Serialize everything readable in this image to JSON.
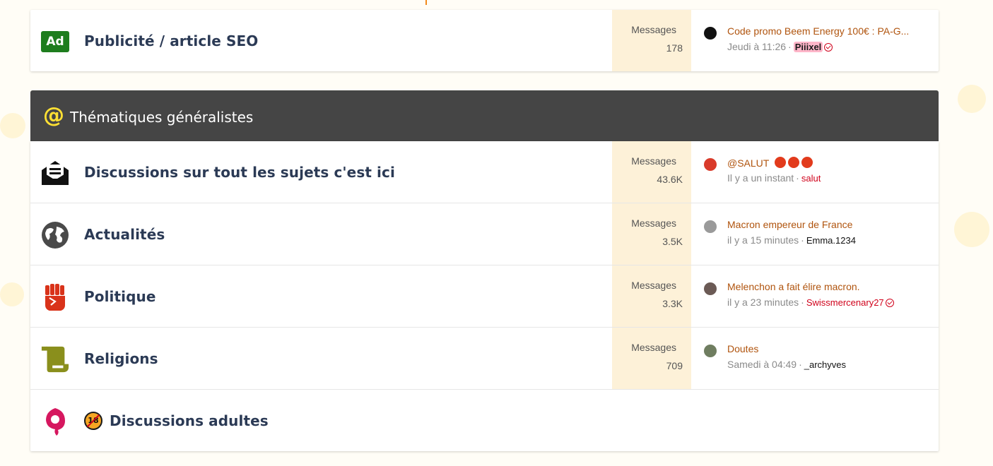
{
  "top_card": {
    "row": {
      "icon": "ad-icon",
      "icon_label": "Ad",
      "title": "Publicité / article SEO",
      "stats_label": "Messages",
      "stats_value": "178",
      "last_topic": "Code promo Beem Energy 100€ : PA-G...",
      "last_time": "Jeudi à 11:26",
      "last_user": "Piiixel"
    }
  },
  "section": {
    "icon": "at-icon",
    "icon_glyph": "@",
    "title": "Thématiques généralistes"
  },
  "rows": [
    {
      "icon": "envelope-open-icon",
      "title": "Discussions sur tout les sujets c'est ici",
      "stats_label": "Messages",
      "stats_value": "43.6K",
      "last_topic": "@SALUT",
      "last_time": "Il y a un instant",
      "last_user": "salut"
    },
    {
      "icon": "globe-icon",
      "title": "Actualités",
      "stats_label": "Messages",
      "stats_value": "3.5K",
      "last_topic": "Macron empereur de France",
      "last_time": "il y a 15 minutes",
      "last_user": "Emma.1234"
    },
    {
      "icon": "fist-icon",
      "title": "Politique",
      "stats_label": "Messages",
      "stats_value": "3.3K",
      "last_topic": "Melenchon a fait élire macron.",
      "last_time": "il y a 23 minutes",
      "last_user": "Swissmercenary27"
    },
    {
      "icon": "scroll-icon",
      "title": "Religions",
      "stats_label": "Messages",
      "stats_value": "709",
      "last_topic": "Doutes",
      "last_time": "Samedi à 04:49",
      "last_user": "_archyves"
    },
    {
      "icon": "adult-flame-icon",
      "badge": "18",
      "title": "Discussions adultes"
    }
  ],
  "colors": {
    "header_bg": "#454545",
    "accent_link": "#b0540e",
    "stats_bg": "#fdf1d8",
    "title_text": "#2b3a55"
  }
}
